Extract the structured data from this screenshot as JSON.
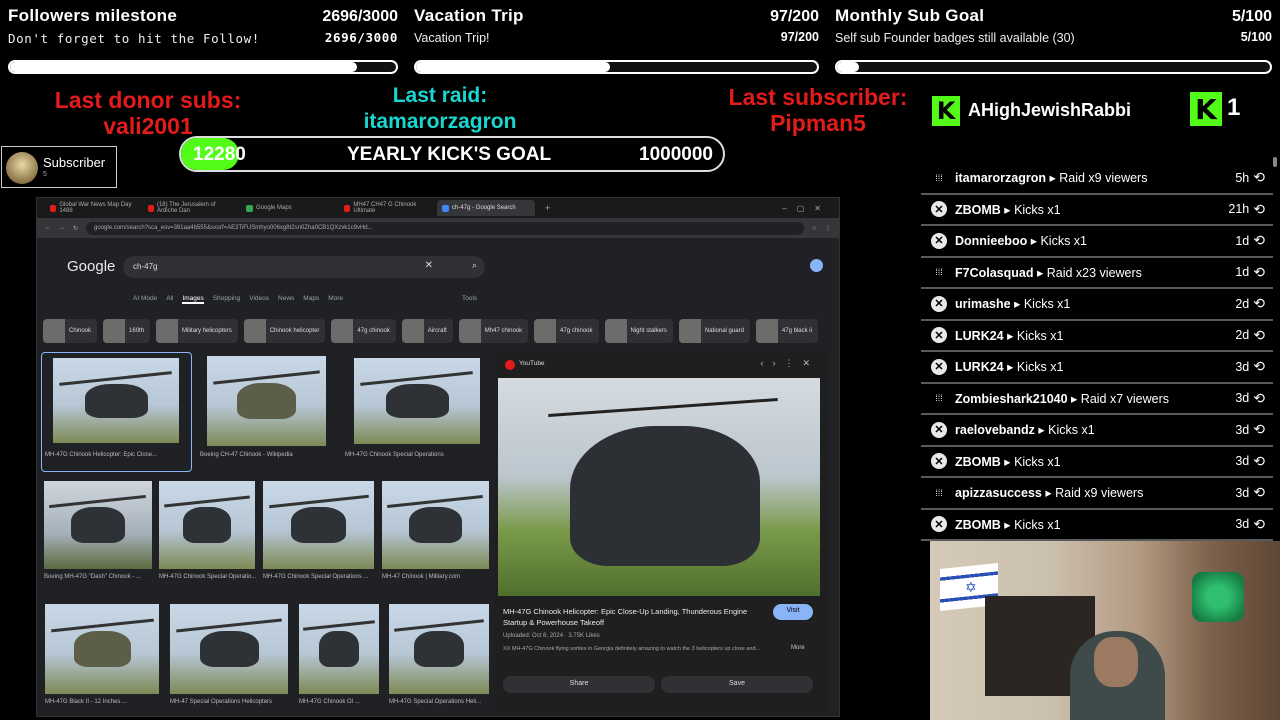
{
  "goals": [
    {
      "title": "Followers milestone",
      "count": "2696/3000",
      "subtitle": "Don't forget to hit the Follow!",
      "count2": "2696/3000",
      "progress": 0.899
    },
    {
      "title": "Vacation Trip",
      "count": "97/200",
      "subtitle": "Vacation Trip!",
      "count2": "97/200",
      "progress": 0.485
    },
    {
      "title": "Monthly Sub Goal",
      "count": "5/100",
      "subtitle": "Self sub Founder badges still available (30)",
      "count2": "5/100",
      "progress": 0.05
    }
  ],
  "labels": {
    "last_donor_label": "Last donor subs:",
    "last_donor_value": "vali2001",
    "last_raid_label": "Last raid:",
    "last_raid_value": "itamarorzagron",
    "last_sub_label": "Last subscriber:",
    "last_sub_value": "Pipman5",
    "top_user": "AHighJewishRabbi",
    "kick_count": "1"
  },
  "colors": {
    "red": "#e21b1b",
    "teal": "#19d6d0",
    "kick_green": "#53fc18"
  },
  "subscriber_badge": {
    "label": "Subscriber",
    "count": "5"
  },
  "kick_goal": {
    "current": "12280",
    "title": "YEARLY KICK'S GOAL",
    "target": "1000000",
    "progress": 0.0123
  },
  "browser": {
    "tabs": [
      "Global War News Map Day 1488",
      "(18) The Jerusalem of Ardiche Dan",
      "Google Maps",
      "MH47 CH47 G Chinook Ultimate",
      "ch-47g - Google Search"
    ],
    "url": "google.com/search?sca_esv=391aa4b555&sxsrf=AE3TiFUSmhyo006xg8t2sn0Zha0CB1QXzvk1c9vHd...",
    "logo": "Google",
    "query": "ch-47g",
    "nav": [
      "AI Mode",
      "All",
      "Images",
      "Shopping",
      "Videos",
      "News",
      "Maps",
      "More",
      "Tools"
    ],
    "chips": [
      "Chinook",
      "160th",
      "Military helicopters",
      "Chinook helicopter",
      "47g chinook",
      "Aircraft",
      "Mh47 chinook",
      "47g chinook",
      "Night stalkers",
      "National guard",
      "47g black ii"
    ],
    "captions": [
      "MH-47G Chinook Helicopter: Epic Close...",
      "Boeing CH-47 Chinook - Wikipedia",
      "MH-47G Chinook Special Operations",
      "Boeing MH-47G \"Dash\" Chinook - ...",
      "MH-47G Chinook Special Operatio...",
      "MH-47G Chinook Special Operations ...",
      "MH-47 Chinook | Military.com",
      "MH-47G Black II - 12 Inches ...",
      "MH-47 Special Operations Helicopters",
      "MH-47G Chinook Ol ...",
      "MH-47G Special Operations Heli..."
    ],
    "panel": {
      "source": "YouTube",
      "title": "MH-47G Chinook Helicopter: Epic Close-Up Landing, Thunderous Engine Startup & Powerhouse Takeoff",
      "uploaded": "Uploaded: Oct 8, 2024 · 3.75K Likes",
      "desc": "XX MH-47G Chinook flying sorties in Georgia definitely amazing to watch the 3 helicopters up close and...",
      "more": "More",
      "visit": "Visit",
      "share": "Share",
      "save": "Save"
    }
  },
  "events": [
    {
      "icon": "raid",
      "user": "itamarorzagron",
      "action": "Raid x9 viewers",
      "time": "5h"
    },
    {
      "icon": "kick",
      "user": "ZBOMB",
      "action": "Kicks x1",
      "time": "21h"
    },
    {
      "icon": "kick",
      "user": "Donnieeboo",
      "action": "Kicks x1",
      "time": "1d"
    },
    {
      "icon": "raid",
      "user": "F7Colasquad",
      "action": "Raid x23 viewers",
      "time": "1d"
    },
    {
      "icon": "kick",
      "user": "urimashe",
      "action": "Kicks x1",
      "time": "2d"
    },
    {
      "icon": "kick",
      "user": "LURK24",
      "action": "Kicks x1",
      "time": "2d"
    },
    {
      "icon": "kick",
      "user": "LURK24",
      "action": "Kicks x1",
      "time": "3d"
    },
    {
      "icon": "raid",
      "user": "Zombieshark21040",
      "action": "Raid x7 viewers",
      "time": "3d"
    },
    {
      "icon": "kick",
      "user": "raelovebandz",
      "action": "Kicks x1",
      "time": "3d"
    },
    {
      "icon": "kick",
      "user": "ZBOMB",
      "action": "Kicks x1",
      "time": "3d"
    },
    {
      "icon": "raid",
      "user": "apizzasuccess",
      "action": "Raid x9 viewers",
      "time": "3d"
    },
    {
      "icon": "kick",
      "user": "ZBOMB",
      "action": "Kicks x1",
      "time": "3d"
    }
  ]
}
